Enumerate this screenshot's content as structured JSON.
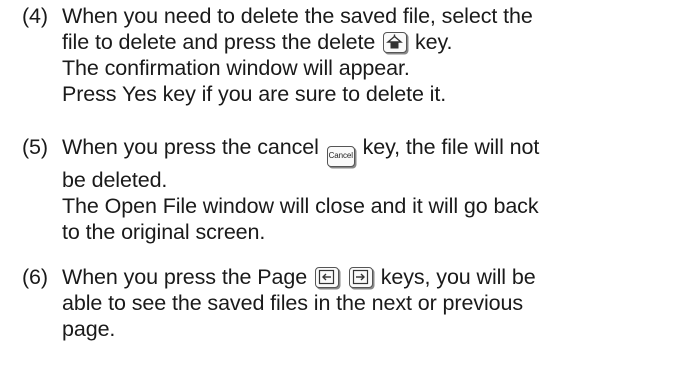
{
  "steps": [
    {
      "number": "(4)",
      "lines": [
        {
          "before": "When you need to delete the saved file, select the"
        },
        {
          "before": "file to delete and press the delete",
          "key": "delete-icon",
          "after": "key."
        },
        {
          "before": "The confirmation window will appear."
        },
        {
          "before": "Press Yes key if you are sure to delete it."
        }
      ]
    },
    {
      "number": "(5)",
      "lines": [
        {
          "before": "When you press the cancel",
          "key_label": "Cancel",
          "after": "key, the file will not"
        },
        {
          "before": "be deleted."
        },
        {
          "before": "The Open File window will close and it will go back"
        },
        {
          "before": "to the original screen."
        }
      ]
    },
    {
      "number": "(6)",
      "lines": [
        {
          "before": "When you press the Page",
          "keys": [
            "page-previous-icon",
            "page-next-icon"
          ],
          "after": "keys, you will be"
        },
        {
          "before": "able to see the saved files in the next or previous"
        },
        {
          "before": "page."
        }
      ]
    }
  ]
}
